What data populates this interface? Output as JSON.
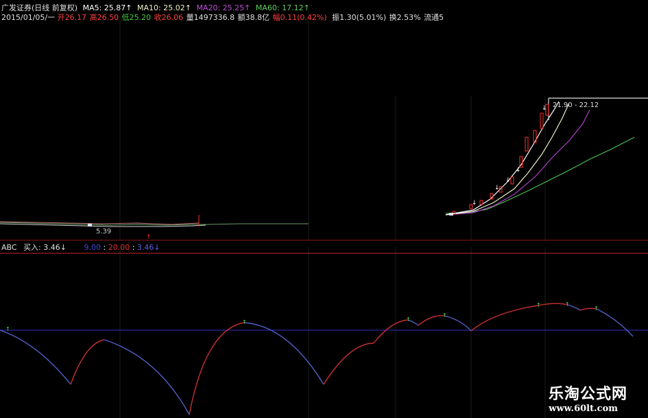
{
  "header": {
    "title": "广发证券(日线 前复权)",
    "ma5": "MA5: 25.87↑",
    "ma10": "MA10: 25.02↑",
    "ma20": "MA20: 25.25↑",
    "ma60": "MA60: 17.12↑",
    "date": "2015/01/05/一",
    "open": "开26.17",
    "high": "高26.50",
    "low": "低25.20",
    "close": "收26.06",
    "volume": "量1497336.8",
    "amount": "额38.8亿",
    "change": "幅0.11(0.42%)",
    "amplitude": "振1.30(5.01%)",
    "turnover": "换2.53%",
    "float": "流通5"
  },
  "price_chart": {
    "range_label": "21.90 - 22.12",
    "low_label": "5.39",
    "colors": {
      "ma5": "#ffffff",
      "ma10": "#f0f0c8",
      "ma20": "#b040c8",
      "ma60": "#50c050",
      "up": "#ff3030",
      "frame": "#cc2020"
    }
  },
  "indicator": {
    "name": "ABC",
    "buy_label": "买入: 3.46↓",
    "v1": "9.00",
    "sep": ":",
    "v2": "20.00",
    "sep2": ":",
    "v3": "3.46↓",
    "colors": {
      "blue": "#2828c8",
      "red": "#c82828"
    }
  },
  "watermark": {
    "text": "乐淘公式网",
    "url": "www.60lt.com"
  }
}
